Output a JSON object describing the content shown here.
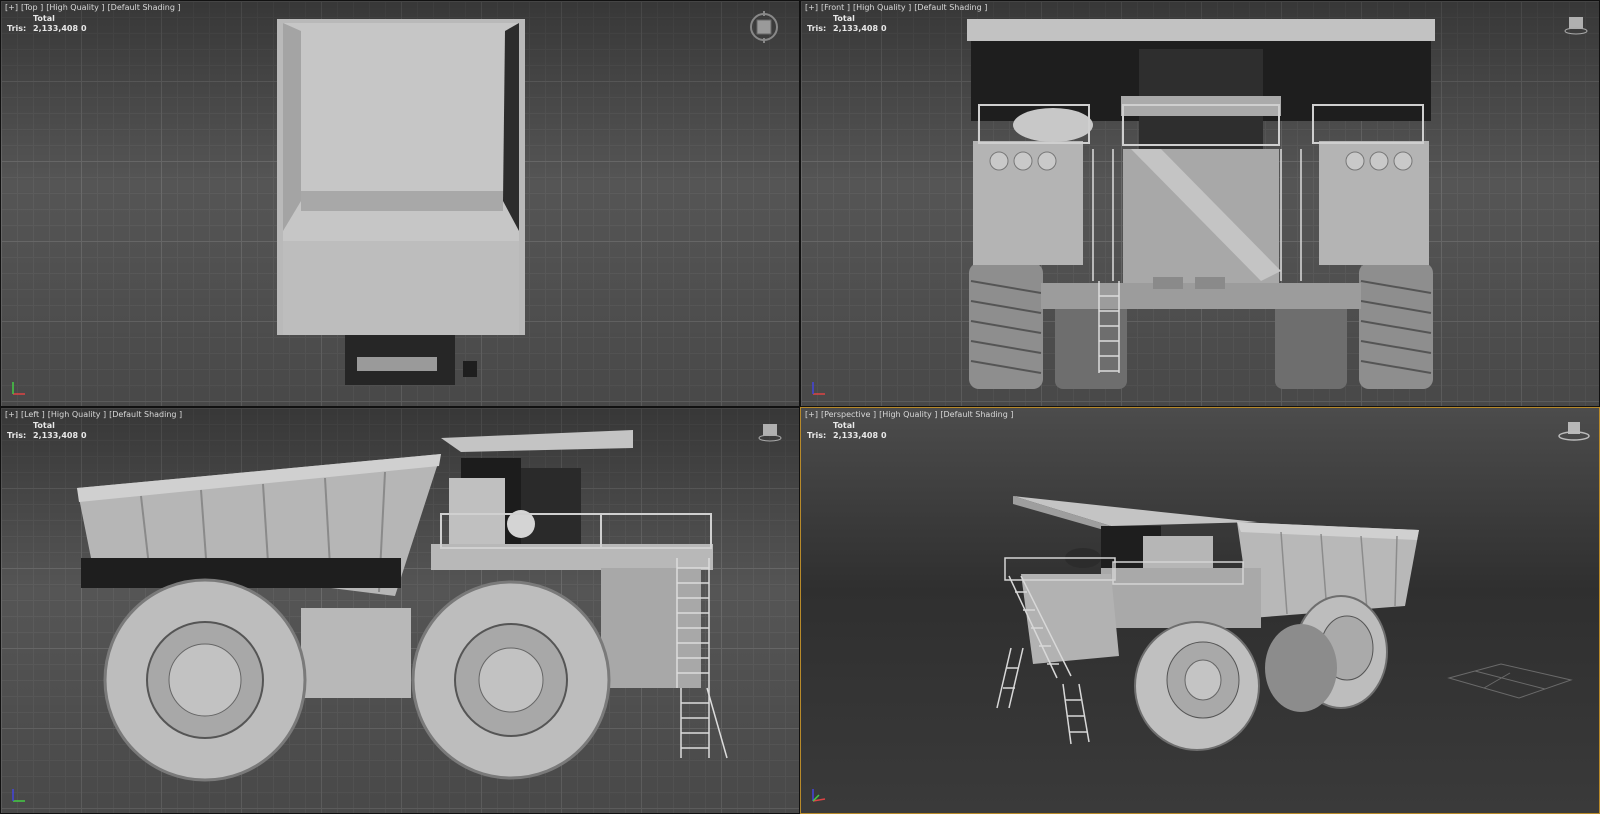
{
  "viewports": {
    "top": {
      "label": [
        "[+]",
        "[Top ]",
        "[High Quality ]",
        "[Default Shading ]"
      ],
      "stats": {
        "header": "Total",
        "tris_label": "Tris:",
        "tris_value": "2,133,408",
        "tris_sel": "0"
      }
    },
    "front": {
      "label": [
        "[+]",
        "[Front ]",
        "[High Quality ]",
        "[Default Shading ]"
      ],
      "stats": {
        "header": "Total",
        "tris_label": "Tris:",
        "tris_value": "2,133,408",
        "tris_sel": "0"
      }
    },
    "left": {
      "label": [
        "[+]",
        "[Left ]",
        "[High Quality ]",
        "[Default Shading ]"
      ],
      "stats": {
        "header": "Total",
        "tris_label": "Tris:",
        "tris_value": "2,133,408",
        "tris_sel": "0"
      }
    },
    "perspective": {
      "label": [
        "[+]",
        "[Perspective ]",
        "[High Quality ]",
        "[Default Shading ]"
      ],
      "stats": {
        "header": "Total",
        "tris_label": "Tris:",
        "tris_value": "2,133,408",
        "tris_sel": "0"
      }
    }
  },
  "colors": {
    "model": "#bcbcbc",
    "model_dark": "#2a2a2a",
    "active_border": "#b88a2a"
  }
}
